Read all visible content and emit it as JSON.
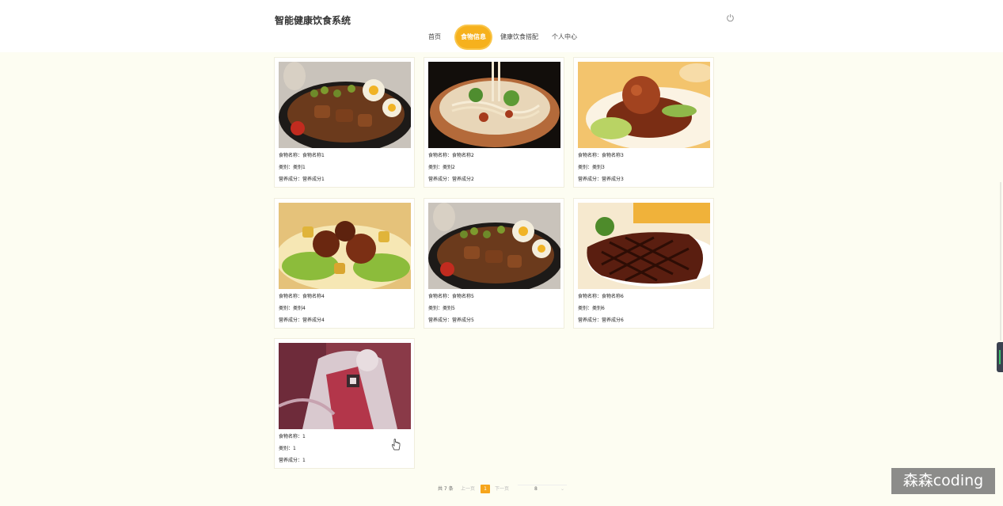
{
  "header": {
    "site_title": "智能健康饮食系统",
    "nav": [
      {
        "label": "首页",
        "active": false
      },
      {
        "label": "食物信息",
        "active": true
      },
      {
        "label": "健康饮食搭配",
        "active": false
      },
      {
        "label": "个人中心",
        "active": false
      }
    ],
    "power_icon": "power-icon"
  },
  "foods": [
    {
      "name_line": "食物名称：食物名称1",
      "category_line": "类别：类别1",
      "nutrition_line": "营养成分：营养成分1",
      "image": "braised-pork-rice"
    },
    {
      "name_line": "食物名称：食物名称2",
      "category_line": "类别：类别2",
      "nutrition_line": "营养成分：营养成分2",
      "image": "noodle-bowl"
    },
    {
      "name_line": "食物名称：食物名称3",
      "category_line": "类别：类别3",
      "nutrition_line": "营养成分：营养成分3",
      "image": "meatball-greens"
    },
    {
      "name_line": "食物名称：食物名称4",
      "category_line": "类别：类别4",
      "nutrition_line": "营养成分：营养成分4",
      "image": "braised-chicken-potato"
    },
    {
      "name_line": "食物名称：食物名称5",
      "category_line": "类别：类别5",
      "nutrition_line": "营养成分：营养成分5",
      "image": "braised-pork-rice"
    },
    {
      "name_line": "食物名称：食物名称6",
      "category_line": "类别：类别6",
      "nutrition_line": "营养成分：营养成分6",
      "image": "grilled-steak"
    },
    {
      "name_line": "食物名称：1",
      "category_line": "类别：1",
      "nutrition_line": "营养成分：1",
      "image": "anime-character"
    }
  ],
  "pagination": {
    "total": "共 7 条",
    "prev": "上一页",
    "current": "1",
    "next": "下一页",
    "page_size": "8"
  },
  "watermark": "森森coding"
}
